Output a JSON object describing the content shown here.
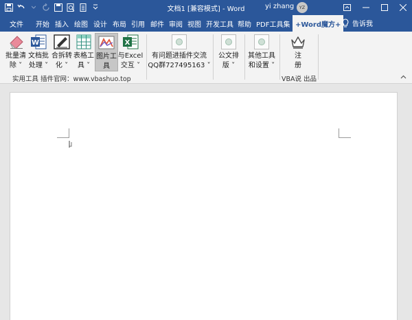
{
  "window": {
    "title": "文档1 [兼容模式] - Word",
    "user_name": "yi zhang",
    "user_initials": "YZ"
  },
  "tabs": [
    "文件",
    "开始",
    "插入",
    "绘图",
    "设计",
    "布局",
    "引用",
    "邮件",
    "审阅",
    "视图",
    "开发工具",
    "帮助",
    "PDF工具集",
    "+Word魔方+"
  ],
  "active_tab": "+Word魔方+",
  "tell_me": "告诉我",
  "ribbon": {
    "buttons": [
      {
        "label1": "批量清",
        "label2": "除 ˅"
      },
      {
        "label1": "文档批",
        "label2": "处理 ˅"
      },
      {
        "label1": "合拆转",
        "label2": "化 ˅"
      },
      {
        "label1": "表格工",
        "label2": "具 ˅"
      },
      {
        "label1": "图片工",
        "label2": "具"
      },
      {
        "label1": "与Excel",
        "label2": "交互 ˅"
      }
    ],
    "group1_label": "实用工具  插件官网：www.vbashuo.top",
    "contact": {
      "label1": "有问题进插件交流",
      "label2": "QQ群727495163 ˅"
    },
    "official_doc": {
      "label1": "公文排",
      "label2": "版 ˅"
    },
    "other_tools": {
      "label1": "其他工具",
      "label2": "和设置 ˅"
    },
    "register": {
      "label1": "注",
      "label2": "册"
    },
    "group_vba_label": "VBA说 出品"
  },
  "colors": {
    "title_bar": "#2b579a",
    "ribbon_bg": "#f3f3f3",
    "doc_bg": "#e6e6e6"
  }
}
